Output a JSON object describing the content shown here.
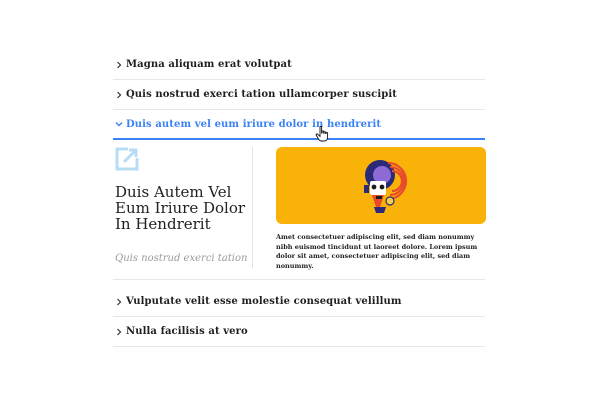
{
  "accordion": {
    "items": [
      {
        "label": "Magna aliquam erat volutpat",
        "expanded": false
      },
      {
        "label": "Quis nostrud exerci tation ullamcorper suscipit",
        "expanded": false
      },
      {
        "label": "Duis autem vel eum iriure dolor in hendrerit",
        "expanded": true
      },
      {
        "label": "Vulputate velit esse molestie consequat velillum",
        "expanded": false
      },
      {
        "label": "Nulla facilisis at vero",
        "expanded": false
      }
    ],
    "panel": {
      "title": "Duis Autem Vel Eum Iriure Dolor In Hendrerit",
      "subtitle": "Quis nostrud exerci tation",
      "body": "Amet consectetuer adipiscing elit, sed diam nonummy nibh euismod tincidunt ut laoreet dolore. Lorem ipsum dolor sit amet, consectetuer adipiscing elit, sed diam nonummy.",
      "icon": "external-link-icon",
      "image": "abstract-face-illustration"
    }
  },
  "colors": {
    "accent": "#3b82f6",
    "icon_light": "#b9dcf5",
    "art_background": "#f9b208",
    "divider": "#e7e7e7"
  }
}
